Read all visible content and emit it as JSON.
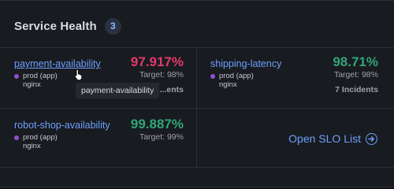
{
  "panel": {
    "title": "Service Health",
    "count": "3"
  },
  "slos": [
    {
      "name": "payment-availability",
      "value": "97.917%",
      "target": "Target: 98%",
      "env": "prod (app)",
      "service": "nginx",
      "incidents": "...ents",
      "status": "bad"
    },
    {
      "name": "shipping-latency",
      "value": "98.71%",
      "target": "Target: 98%",
      "env": "prod (app)",
      "service": "nginx",
      "incidents": "7 Incidents",
      "status": "good"
    },
    {
      "name": "robot-shop-availability",
      "value": "99.887%",
      "target": "Target: 99%",
      "env": "prod (app)",
      "service": "nginx",
      "status": "good"
    }
  ],
  "tooltip": "payment-availability",
  "footer": {
    "open_slo_list": "Open SLO List"
  },
  "colors": {
    "link": "#6e9fff",
    "bad": "#e33a6e",
    "good": "#31a57a",
    "env_dot": "#8e4fd3"
  },
  "icons": {
    "cursor": "hand-pointer-icon",
    "env": "env-dot-icon",
    "open": "arrow-right-circle-icon"
  }
}
